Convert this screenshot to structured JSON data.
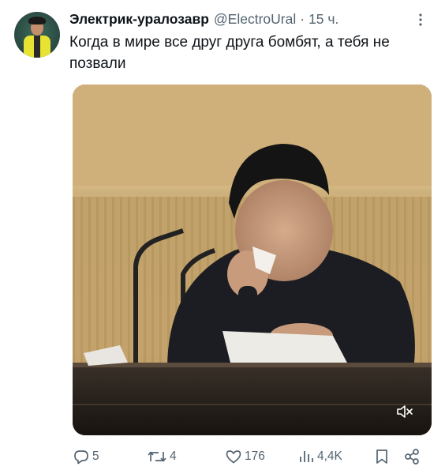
{
  "tweet": {
    "author": {
      "display_name": "Электрик-уралозавр",
      "handle": "@ElectroUral",
      "separator": "·",
      "time": "15 ч."
    },
    "text": "Когда в мире все друг друга бомбят, а тебя не позвали",
    "media": {
      "type": "video",
      "icon": "mute-icon"
    },
    "actions": {
      "reply": {
        "icon": "reply-icon",
        "count": "5"
      },
      "retweet": {
        "icon": "retweet-icon",
        "count": "4"
      },
      "like": {
        "icon": "heart-icon",
        "count": "176"
      },
      "views": {
        "icon": "views-icon",
        "count": "4,4K"
      },
      "bookmark": {
        "icon": "bookmark-icon"
      },
      "share": {
        "icon": "share-icon"
      }
    }
  },
  "colors": {
    "text": "#0f1419",
    "secondary": "#536471",
    "background": "#ffffff"
  }
}
